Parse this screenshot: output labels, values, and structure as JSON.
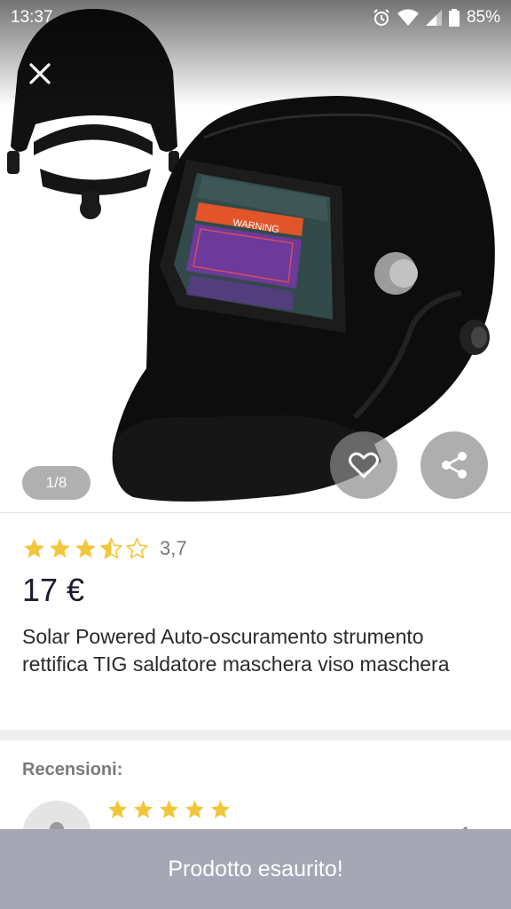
{
  "status_bar": {
    "time": "13:37",
    "battery": "85%",
    "icons": [
      "alarm-icon",
      "wifi-icon",
      "signal-icon",
      "battery-icon"
    ]
  },
  "gallery": {
    "page_indicator": "1/8",
    "close_icon": "close-icon",
    "favorite_icon": "heart-icon",
    "share_icon": "share-icon",
    "product_image_text": "WARNING"
  },
  "product": {
    "rating": 3.7,
    "rating_label": "3,7",
    "price": "17 €",
    "title": "Solar Powered Auto-oscuramento strumento rettifica TIG saldatore maschera viso maschera"
  },
  "reviews": {
    "label": "Recensioni:",
    "first_review_rating": 5
  },
  "bottom_bar": {
    "label": "Prodotto esaurito!"
  },
  "colors": {
    "star": "#f2c63a",
    "bottom_bar": "#a6a7b5",
    "price_text": "#1b1b2b"
  }
}
